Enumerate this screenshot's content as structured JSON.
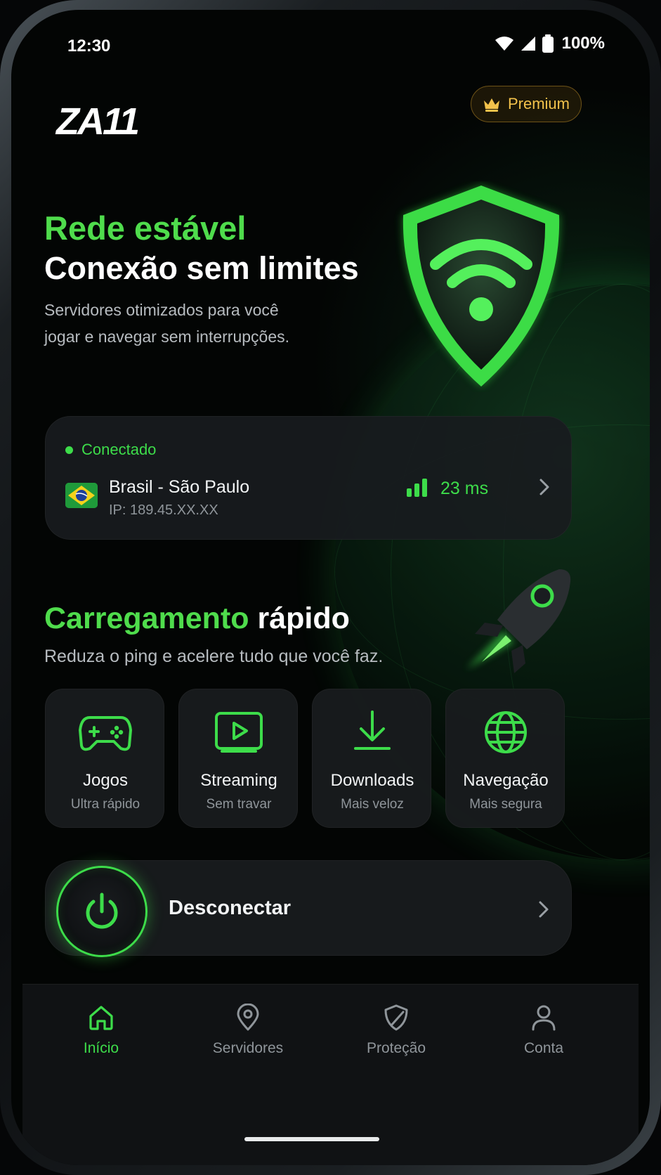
{
  "status_bar": {
    "time": "12:30",
    "battery": "100%"
  },
  "header": {
    "logo": "ZA11",
    "premium_label": "Premium"
  },
  "hero": {
    "line1": "Rede estável",
    "line2": "Conexão sem limites",
    "description_l1": "Servidores otimizados para você",
    "description_l2": "jogar e navegar sem interrupções."
  },
  "connection": {
    "status": "Conectado",
    "server": "Brasil - São Paulo",
    "ip": "IP: 189.45.XX.XX",
    "ping": "23 ms"
  },
  "speed": {
    "title_accent": "Carregamento",
    "title_rest": "rápido",
    "description": "Reduza o ping e acelere tudo que você faz."
  },
  "features": [
    {
      "title": "Jogos",
      "subtitle": "Ultra rápido",
      "icon": "gamepad-icon"
    },
    {
      "title": "Streaming",
      "subtitle": "Sem travar",
      "icon": "play-icon"
    },
    {
      "title": "Downloads",
      "subtitle": "Mais veloz",
      "icon": "download-icon"
    },
    {
      "title": "Navegação",
      "subtitle": "Mais segura",
      "icon": "globe-icon"
    }
  ],
  "disconnect": {
    "label": "Desconectar"
  },
  "nav": [
    {
      "label": "Início",
      "icon": "home-icon",
      "active": true
    },
    {
      "label": "Servidores",
      "icon": "location-pin-icon",
      "active": false
    },
    {
      "label": "Proteção",
      "icon": "shield-icon",
      "active": false
    },
    {
      "label": "Conta",
      "icon": "user-icon",
      "active": false
    }
  ],
  "colors": {
    "accent": "#3ddc4a",
    "premium": "#f3c24b",
    "background": "#030504"
  }
}
